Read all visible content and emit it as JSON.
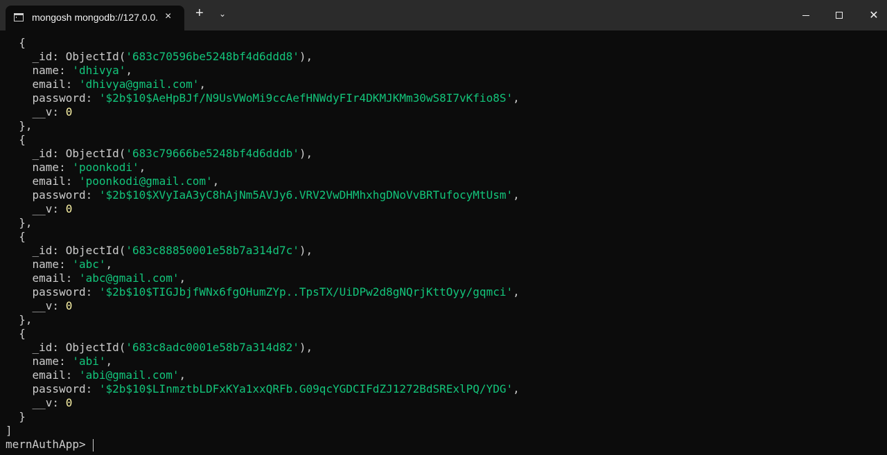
{
  "window": {
    "tab_title": "mongosh mongodb://127.0.0.",
    "tab_close_icon": "×",
    "new_tab_icon": "+",
    "dropdown_icon": "⌄",
    "minimize_icon": "—",
    "maximize_icon": "□",
    "close_icon": "✕"
  },
  "terminal": {
    "prompt": "mernAuthApp>",
    "records": [
      {
        "id": "683c70596be5248bf4d6ddd8",
        "name": "dhivya",
        "email": "dhivya@gmail.com",
        "password": "$2b$10$AeHpBJf/N9UsVWoMi9ccAefHNWdyFIr4DKMJKMm30wS8I7vKfio8S",
        "v": "0"
      },
      {
        "id": "683c79666be5248bf4d6dddb",
        "name": "poonkodi",
        "email": "poonkodi@gmail.com",
        "password": "$2b$10$XVyIaA3yC8hAjNm5AVJy6.VRV2VwDHMhxhgDNoVvBRTufocyMtUsm",
        "v": "0"
      },
      {
        "id": "683c88850001e58b7a314d7c",
        "name": "abc",
        "email": "abc@gmail.com",
        "password": "$2b$10$TIGJbjfWNx6fgOHumZYp..TpsTX/UiDPw2d8gNQrjKttOyy/gqmci",
        "v": "0"
      },
      {
        "id": "683c8adc0001e58b7a314d82",
        "name": "abi",
        "email": "abi@gmail.com",
        "password": "$2b$10$LInmztbLDFxKYa1xxQRFb.G09qcYGDCIFdZJ1272BdSRExlPQ/YDG",
        "v": "0"
      }
    ]
  },
  "colors": {
    "background": "#0c0c0c",
    "titlebar": "#2b2b2b",
    "string": "#13c57b",
    "number": "#f9f1a5",
    "text": "#cccccc"
  }
}
